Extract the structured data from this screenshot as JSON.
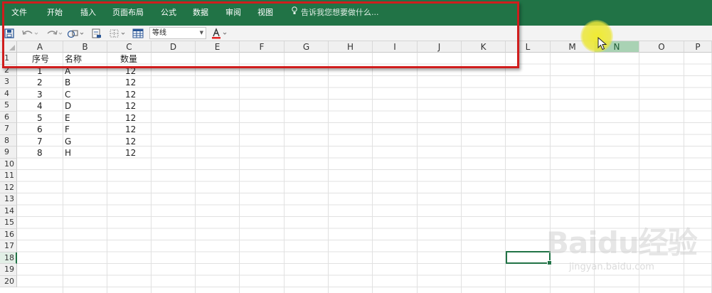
{
  "ribbon": {
    "tabs": [
      "文件",
      "开始",
      "插入",
      "页面布局",
      "公式",
      "数据",
      "审阅",
      "视图"
    ],
    "tell_me": "告诉我您想要做什么..."
  },
  "toolbar": {
    "font_name": "等线",
    "icons": [
      "save-icon",
      "undo-icon",
      "redo-icon",
      "shapes-icon",
      "print-preview-icon",
      "borders-icon",
      "table-icon",
      "font-color-icon"
    ]
  },
  "sheet": {
    "columns": [
      "A",
      "B",
      "C",
      "D",
      "E",
      "F",
      "G",
      "H",
      "I",
      "J",
      "K",
      "L",
      "M",
      "N",
      "O",
      "P"
    ],
    "rows": [
      "1",
      "2",
      "3",
      "4",
      "5",
      "6",
      "7",
      "8",
      "9",
      "10",
      "11",
      "12",
      "13",
      "14",
      "15",
      "16",
      "17",
      "18",
      "19",
      "20"
    ],
    "header": {
      "col_a": "序号",
      "col_b": "名称",
      "col_c": "数量"
    },
    "data": [
      {
        "a": "1",
        "b": "A",
        "c": "12"
      },
      {
        "a": "2",
        "b": "B",
        "c": "12"
      },
      {
        "a": "3",
        "b": "C",
        "c": "12"
      },
      {
        "a": "4",
        "b": "D",
        "c": "12"
      },
      {
        "a": "5",
        "b": "E",
        "c": "12"
      },
      {
        "a": "6",
        "b": "F",
        "c": "12"
      },
      {
        "a": "7",
        "b": "G",
        "c": "12"
      },
      {
        "a": "8",
        "b": "H",
        "c": "12"
      }
    ],
    "selected_column": "N",
    "selected_row": "18"
  },
  "watermark": {
    "logo": "Baidu经验",
    "url": "jingyan.baidu.com"
  },
  "colors": {
    "ribbon": "#217346",
    "annotation": "#d01d1d",
    "highlight": "#efe830"
  }
}
